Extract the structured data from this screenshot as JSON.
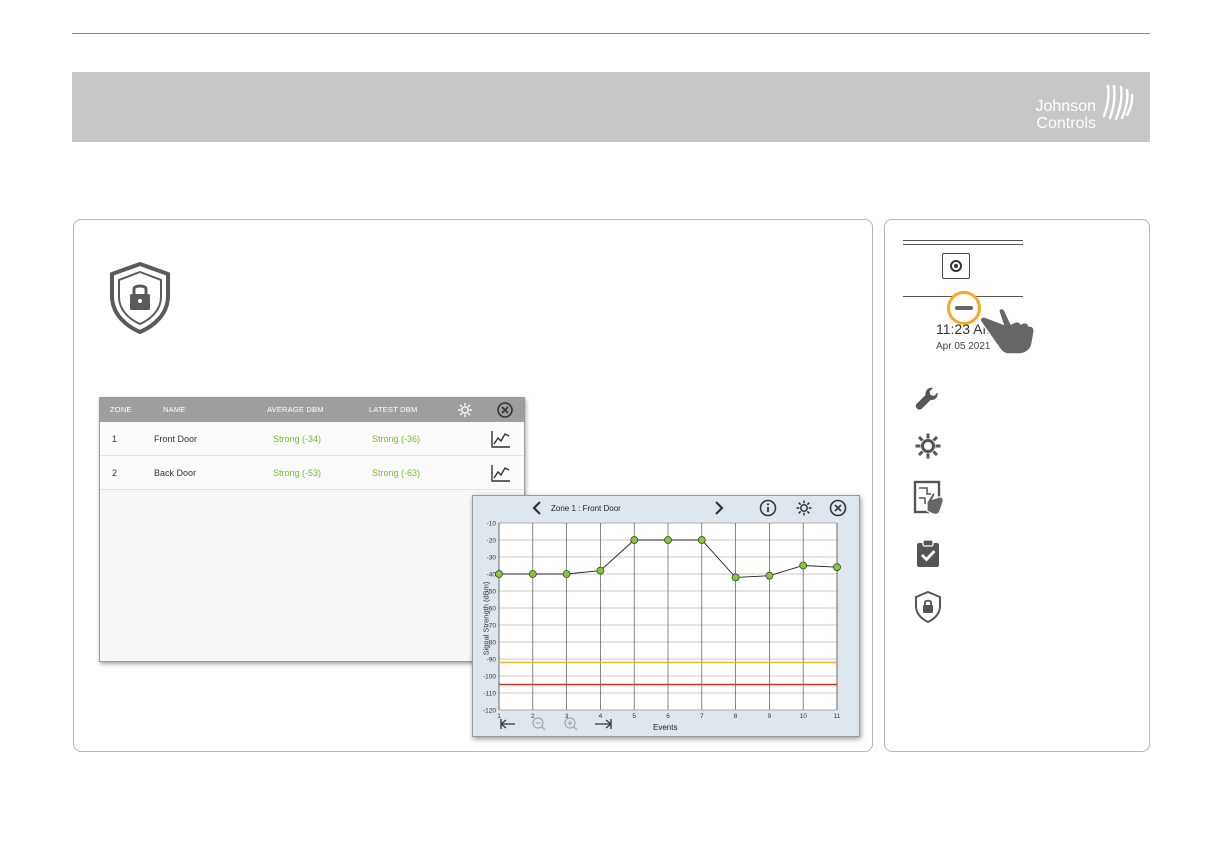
{
  "brand": {
    "line1": "Johnson",
    "line2": "Controls"
  },
  "signal_table": {
    "headers": {
      "zone": "ZONE",
      "name": "NAME",
      "average": "AVERAGE DBM",
      "latest": "LATEST DBM"
    },
    "rows": [
      {
        "zone": "1",
        "name": "Front Door",
        "average": "Strong (-34)",
        "latest": "Strong (-36)"
      },
      {
        "zone": "2",
        "name": "Back Door",
        "average": "Strong (-53)",
        "latest": "Strong (-63)"
      }
    ]
  },
  "chart_window": {
    "title": "Zone 1 :  Front Door"
  },
  "chart_data": {
    "type": "line",
    "xlabel": "Events",
    "ylabel": "Signal Strength (dBm)",
    "x": [
      1,
      2,
      3,
      4,
      5,
      6,
      7,
      8,
      9,
      10,
      11
    ],
    "y": [
      -40,
      -40,
      -40,
      -38,
      -20,
      -20,
      -20,
      -42,
      -41,
      -35,
      -36
    ],
    "xlim": [
      1,
      11
    ],
    "ylim": [
      -120,
      -10
    ],
    "yticks": [
      -10,
      -20,
      -30,
      -40,
      -50,
      -60,
      -70,
      -80,
      -90,
      -100,
      -110,
      -120
    ],
    "xticks": [
      1,
      2,
      3,
      4,
      5,
      6,
      7,
      8,
      9,
      10,
      11
    ],
    "threshold_lines": [
      {
        "value": -92,
        "color": "#f0b429"
      },
      {
        "value": -105,
        "color": "#d9311f"
      }
    ],
    "grid": true,
    "line_color": "#222222",
    "marker_color": "#8bc43f"
  },
  "side_panel": {
    "time": "11:23 AM",
    "date": "Apr 05 2021"
  },
  "icons": {
    "shield": "shield-lock-icon",
    "gear": "gear-icon",
    "close": "close-icon",
    "graph": "line-graph-icon",
    "wrench": "wrench-icon",
    "touch": "touch-panel-icon",
    "clipboard": "clipboard-check-icon"
  },
  "colors": {
    "banner": "#c7c7c7",
    "green_text": "#7cb833",
    "highlight": "#f3a92a"
  }
}
